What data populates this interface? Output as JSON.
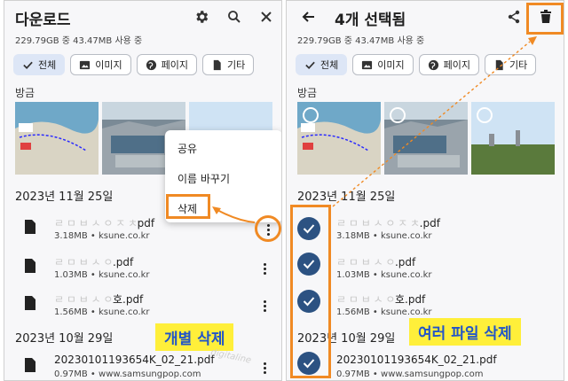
{
  "left": {
    "title": "다운로드",
    "storage": "229.79GB 중 43.47MB 사용 중",
    "chips": [
      {
        "label": "전체",
        "icon": "check-icon",
        "active": true
      },
      {
        "label": "이미지",
        "icon": "image-icon"
      },
      {
        "label": "페이지",
        "icon": "globe-icon"
      },
      {
        "label": "기타",
        "icon": "file-icon"
      }
    ],
    "recent_label": "방금",
    "date1": "2023년 11월 25일",
    "files": [
      {
        "name_hidden": "ㄹ ㅁ ㅂ ㅅ ㅇ ㅈ ㅊ",
        "ext": "pdf",
        "meta": "3.18MB • ksune.co.kr"
      },
      {
        "name_hidden": "ㄹ ㅁ ㅂ ㅅ ㅇ",
        "ext": ".pdf",
        "meta": "1.03MB • ksune.co.kr"
      },
      {
        "name_hidden": "ㄹ ㅁ ㅂ ㅅ ㅇ",
        "ext": "호.pdf",
        "meta": "1.56MB • ksune.co.kr"
      }
    ],
    "date2": "2023년 10월 29일",
    "file4": {
      "name": "20230101193654K_02_21.pdf",
      "meta": "0.97MB • www.samsungpop.com"
    },
    "menu": {
      "share": "공유",
      "rename": "이름 바꾸기",
      "delete": "삭제"
    },
    "callout": "개별 삭제",
    "watermark": "digitaline"
  },
  "right": {
    "title": "4개 선택됨",
    "storage": "229.79GB 중 43.47MB 사용 중",
    "chips": [
      {
        "label": "전체",
        "icon": "check-icon",
        "active": true
      },
      {
        "label": "이미지",
        "icon": "image-icon"
      },
      {
        "label": "페이지",
        "icon": "globe-icon"
      },
      {
        "label": "기타",
        "icon": "file-icon"
      }
    ],
    "recent_label": "방금",
    "date1": "2023년 11월 25일",
    "files": [
      {
        "name_hidden": "ㄹ ㅁ ㅂ ㅅ ㅇ ㅈ ㅊ",
        "ext": ".pdf",
        "meta": "3.18MB • ksune.co.kr"
      },
      {
        "name_hidden": "ㄹ ㅁ ㅂ ㅅ ㅇ",
        "ext": ".pdf",
        "meta": "1.03MB • ksune.co.kr"
      },
      {
        "name_hidden": "ㄹ ㅁ ㅂ ㅅ ㅇ",
        "ext": "호.pdf",
        "meta": "1.56MB • ksune.co.kr"
      }
    ],
    "date2": "2023년 10월 29일",
    "file4": {
      "name": "20230101193654K_02_21.pdf",
      "meta": "0.97MB • www.samsungpop.com"
    },
    "callout": "여러 파일 삭제"
  },
  "colors": {
    "accent_orange": "#f08a24",
    "check_blue": "#2c5282",
    "callout_bg": "#ffef3a",
    "callout_text": "#2255c8"
  }
}
